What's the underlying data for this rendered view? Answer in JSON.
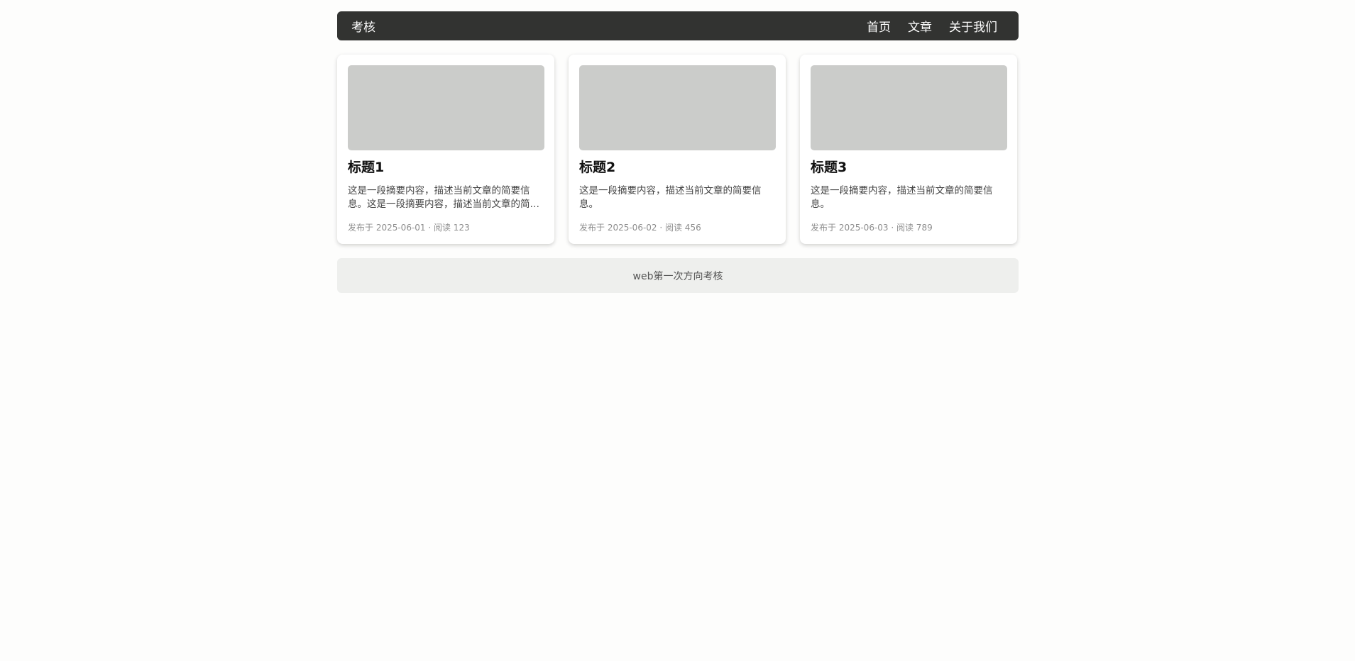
{
  "navbar": {
    "brand": "考核",
    "links": [
      {
        "label": "首页"
      },
      {
        "label": "文章"
      },
      {
        "label": "关于我们"
      }
    ]
  },
  "cards": [
    {
      "title": "标题1",
      "summary": "这是一段摘要内容，描述当前文章的简要信息。这是一段摘要内容，描述当前文章的简要信息。",
      "meta": "发布于 2025-06-01 · 阅读 123"
    },
    {
      "title": "标题2",
      "summary": "这是一段摘要内容，描述当前文章的简要信息。",
      "meta": "发布于 2025-06-02 · 阅读 456"
    },
    {
      "title": "标题3",
      "summary": "这是一段摘要内容，描述当前文章的简要信息。",
      "meta": "发布于 2025-06-03 · 阅读 789"
    }
  ],
  "footer": {
    "text": "web第一次方向考核"
  },
  "colors": {
    "navbar_bg": "#323331",
    "thumb_placeholder": "#cbccca",
    "footer_bg": "#eeefed"
  }
}
